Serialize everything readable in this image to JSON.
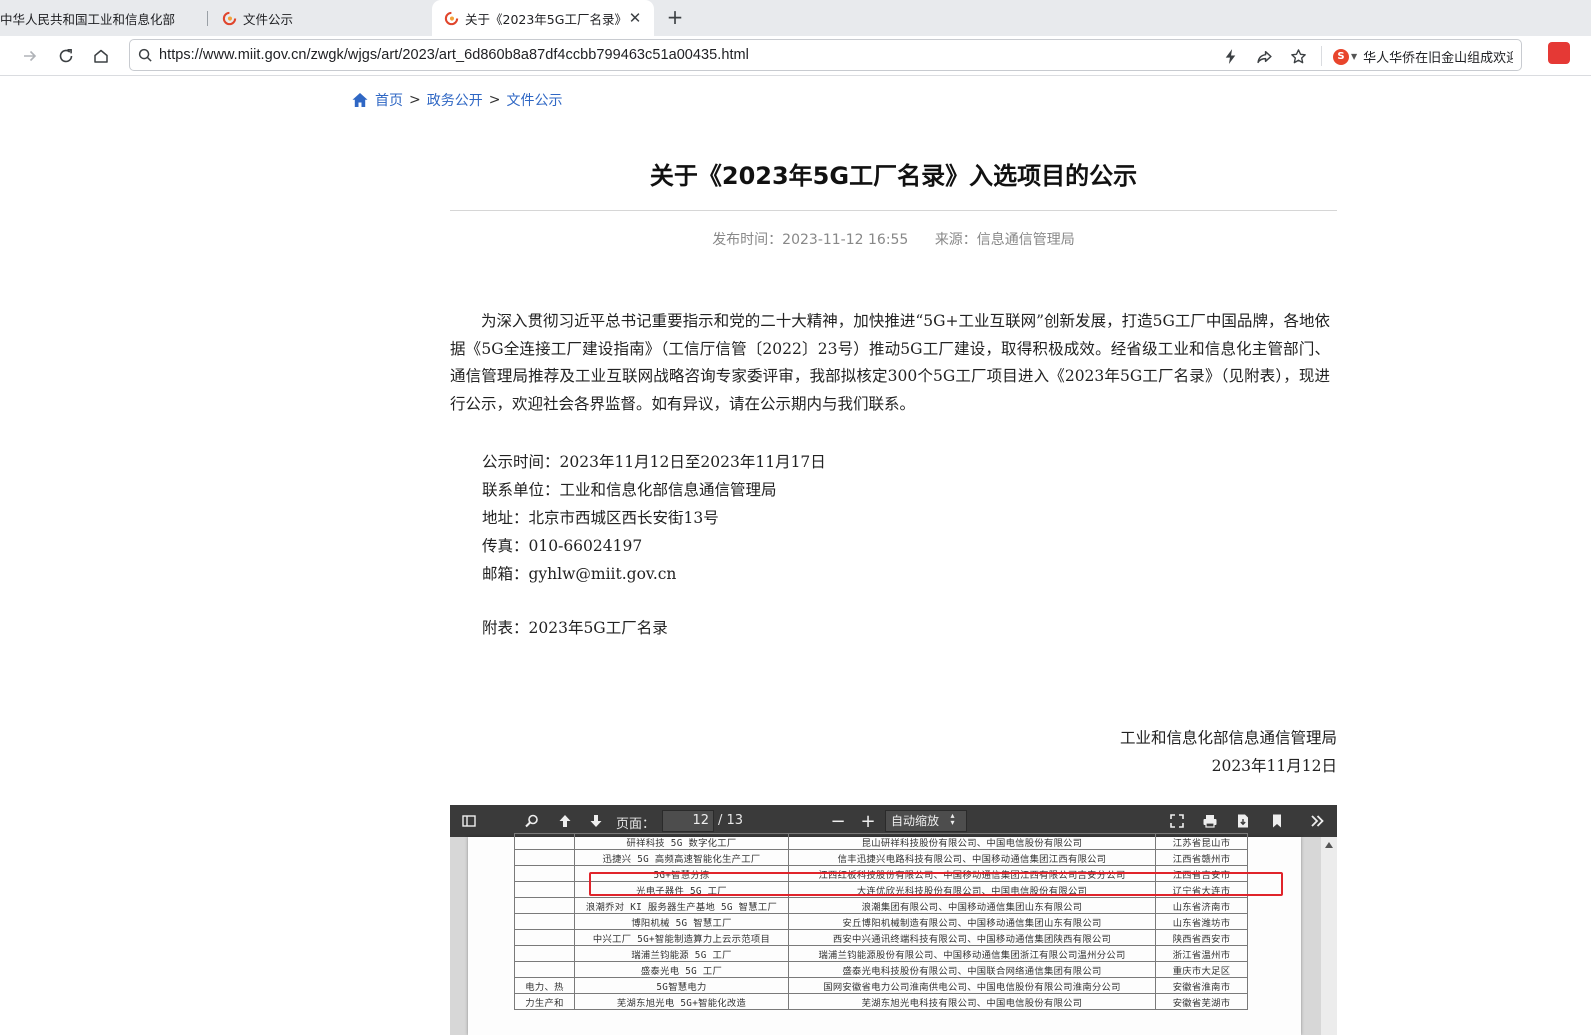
{
  "browser": {
    "tabs": [
      {
        "title": "中华人民共和国工业和信息化部"
      },
      {
        "title": "文件公示"
      },
      {
        "title": "关于《2023年5G工厂名录》入选项目的公示"
      }
    ],
    "close_glyph": "✕",
    "new_tab_glyph": "+",
    "url": "https://www.miit.gov.cn/zwgk/wjgs/art/2023/art_6d860b8a87df4ccbb799463c51a00435.html",
    "search_engine_badge": "S",
    "hot_search": "华人华侨在旧金山组成欢迎"
  },
  "breadcrumb": {
    "home": "首页",
    "sep": ">",
    "level1": "政务公开",
    "level2": "文件公示"
  },
  "article": {
    "title": "关于《2023年5G工厂名录》入选项目的公示",
    "publish_time": "发布时间：2023-11-12 16:55",
    "source": "来源：信息通信管理局",
    "paragraph": "为深入贯彻习近平总书记重要指示和党的二十大精神，加快推进“5G+工业互联网”创新发展，打造5G工厂中国品牌，各地依据《5G全连接工厂建设指南》（工信厅信管〔2022〕23号）推动5G工厂建设，取得积极成效。经省级工业和信息化主管部门、通信管理局推荐及工业互联网战略咨询专家委评审，我部拟核定300个5G工厂项目进入《2023年5G工厂名录》（见附表），现进行公示，欢迎社会各界监督。如有异议，请在公示期内与我们联系。",
    "notice_period": "公示时间：2023年11月12日至2023年11月17日",
    "contact_unit": "联系单位：工业和信息化部信息通信管理局",
    "address": "地址：北京市西城区西长安街13号",
    "fax": "传真：010-66024197",
    "email": "邮箱：gyhlw@miit.gov.cn",
    "attachment": "附表：2023年5G工厂名录",
    "signature": "工业和信息化部信息通信管理局",
    "date": "2023年11月12日"
  },
  "pdf_viewer": {
    "page_label": "页面：",
    "current_page": "12",
    "total_pages": "/ 13",
    "zoom": "自动缩放",
    "zoom_out": "−",
    "zoom_in": "+",
    "rows": [
      {
        "category": "",
        "name": "研祥科技 5G 数字化工厂",
        "company": "昆山研祥科技股份有限公司、中国电信股份有限公司",
        "location": "江苏省昆山市"
      },
      {
        "category": "",
        "name": "迅捷兴 5G 高频高速智能化生产工厂",
        "company": "信丰迅捷兴电路科技有限公司、中国移动通信集团江西有限公司",
        "location": "江西省赣州市"
      },
      {
        "category": "",
        "name": "5G+智慧分拣",
        "company": "江西红板科技股份有限公司、中国移动通信集团江西有限公司吉安分公司",
        "location": "江西省吉安市"
      },
      {
        "category": "",
        "name": "光电子器件 5G 工厂",
        "company": "大连优欣光科技股份有限公司、中国电信股份有限公司",
        "location": "辽宁省大连市"
      },
      {
        "category": "",
        "name": "浪潮乔对 KI 服务器生产基地 5G 智慧工厂",
        "company": "浪潮集团有限公司、中国移动通信集团山东有限公司",
        "location": "山东省济南市"
      },
      {
        "category": "",
        "name": "博阳机械 5G 智慧工厂",
        "company": "安丘博阳机械制造有限公司、中国移动通信集团山东有限公司",
        "location": "山东省潍坊市"
      },
      {
        "category": "",
        "name": "中兴工厂 5G+智能制造算力上云示范项目",
        "company": "西安中兴通讯终端科技有限公司、中国移动通信集团陕西有限公司",
        "location": "陕西省西安市"
      },
      {
        "category": "",
        "name": "瑞浦兰钧能源 5G 工厂",
        "company": "瑞浦兰钧能源股份有限公司、中国移动通信集团浙江有限公司温州分公司",
        "location": "浙江省温州市"
      },
      {
        "category": "",
        "name": "盛泰光电 5G 工厂",
        "company": "盛泰光电科技股份有限公司、中国联合网络通信集团有限公司",
        "location": "重庆市大足区"
      },
      {
        "category": "电力、热",
        "name": "5G智慧电力",
        "company": "国网安徽省电力公司淮南供电公司、中国电信股份有限公司淮南分公司",
        "location": "安徽省淮南市"
      },
      {
        "category": "力生产和",
        "name": "芜湖东旭光电 5G+智能化改造",
        "company": "芜湖东旭光电科技有限公司、中国电信股份有限公司",
        "location": "安徽省芜湖市"
      }
    ]
  }
}
